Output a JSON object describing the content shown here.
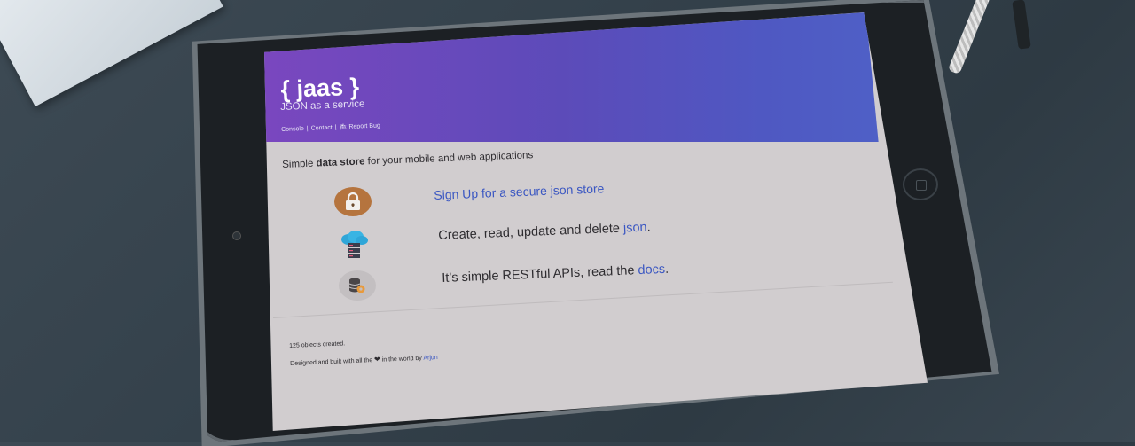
{
  "app": {
    "logo": "{ jaas }",
    "tagline": "JSON as a service"
  },
  "nav": {
    "console": "Console",
    "contact": "Contact",
    "report_bug": "Report Bug",
    "separator": "|"
  },
  "intro": {
    "prefix": "Simple ",
    "bold": "data store",
    "suffix": " for your mobile and web applications"
  },
  "features": {
    "signup_link": "Sign Up for a secure json store",
    "crud_prefix": "Create, read, update and delete ",
    "crud_link": "json",
    "crud_suffix": ".",
    "rest_prefix": "It’s simple RESTful APIs, read the ",
    "rest_link": "docs",
    "rest_suffix": "."
  },
  "icons": {
    "lock": "lock-icon",
    "server": "cloud-server-icon",
    "database": "database-gear-icon",
    "bug": "bug-icon",
    "heart": "heart-icon"
  },
  "footer": {
    "objects_created": "125 objects created.",
    "credit_prefix": "Designed and built with all the",
    "credit_middle": "in the world by",
    "author": "Arjun"
  },
  "colors": {
    "header_start": "#7a47bf",
    "header_end": "#4f63c8",
    "link": "#3b57c2",
    "screen_bg": "#d1cdcf"
  }
}
